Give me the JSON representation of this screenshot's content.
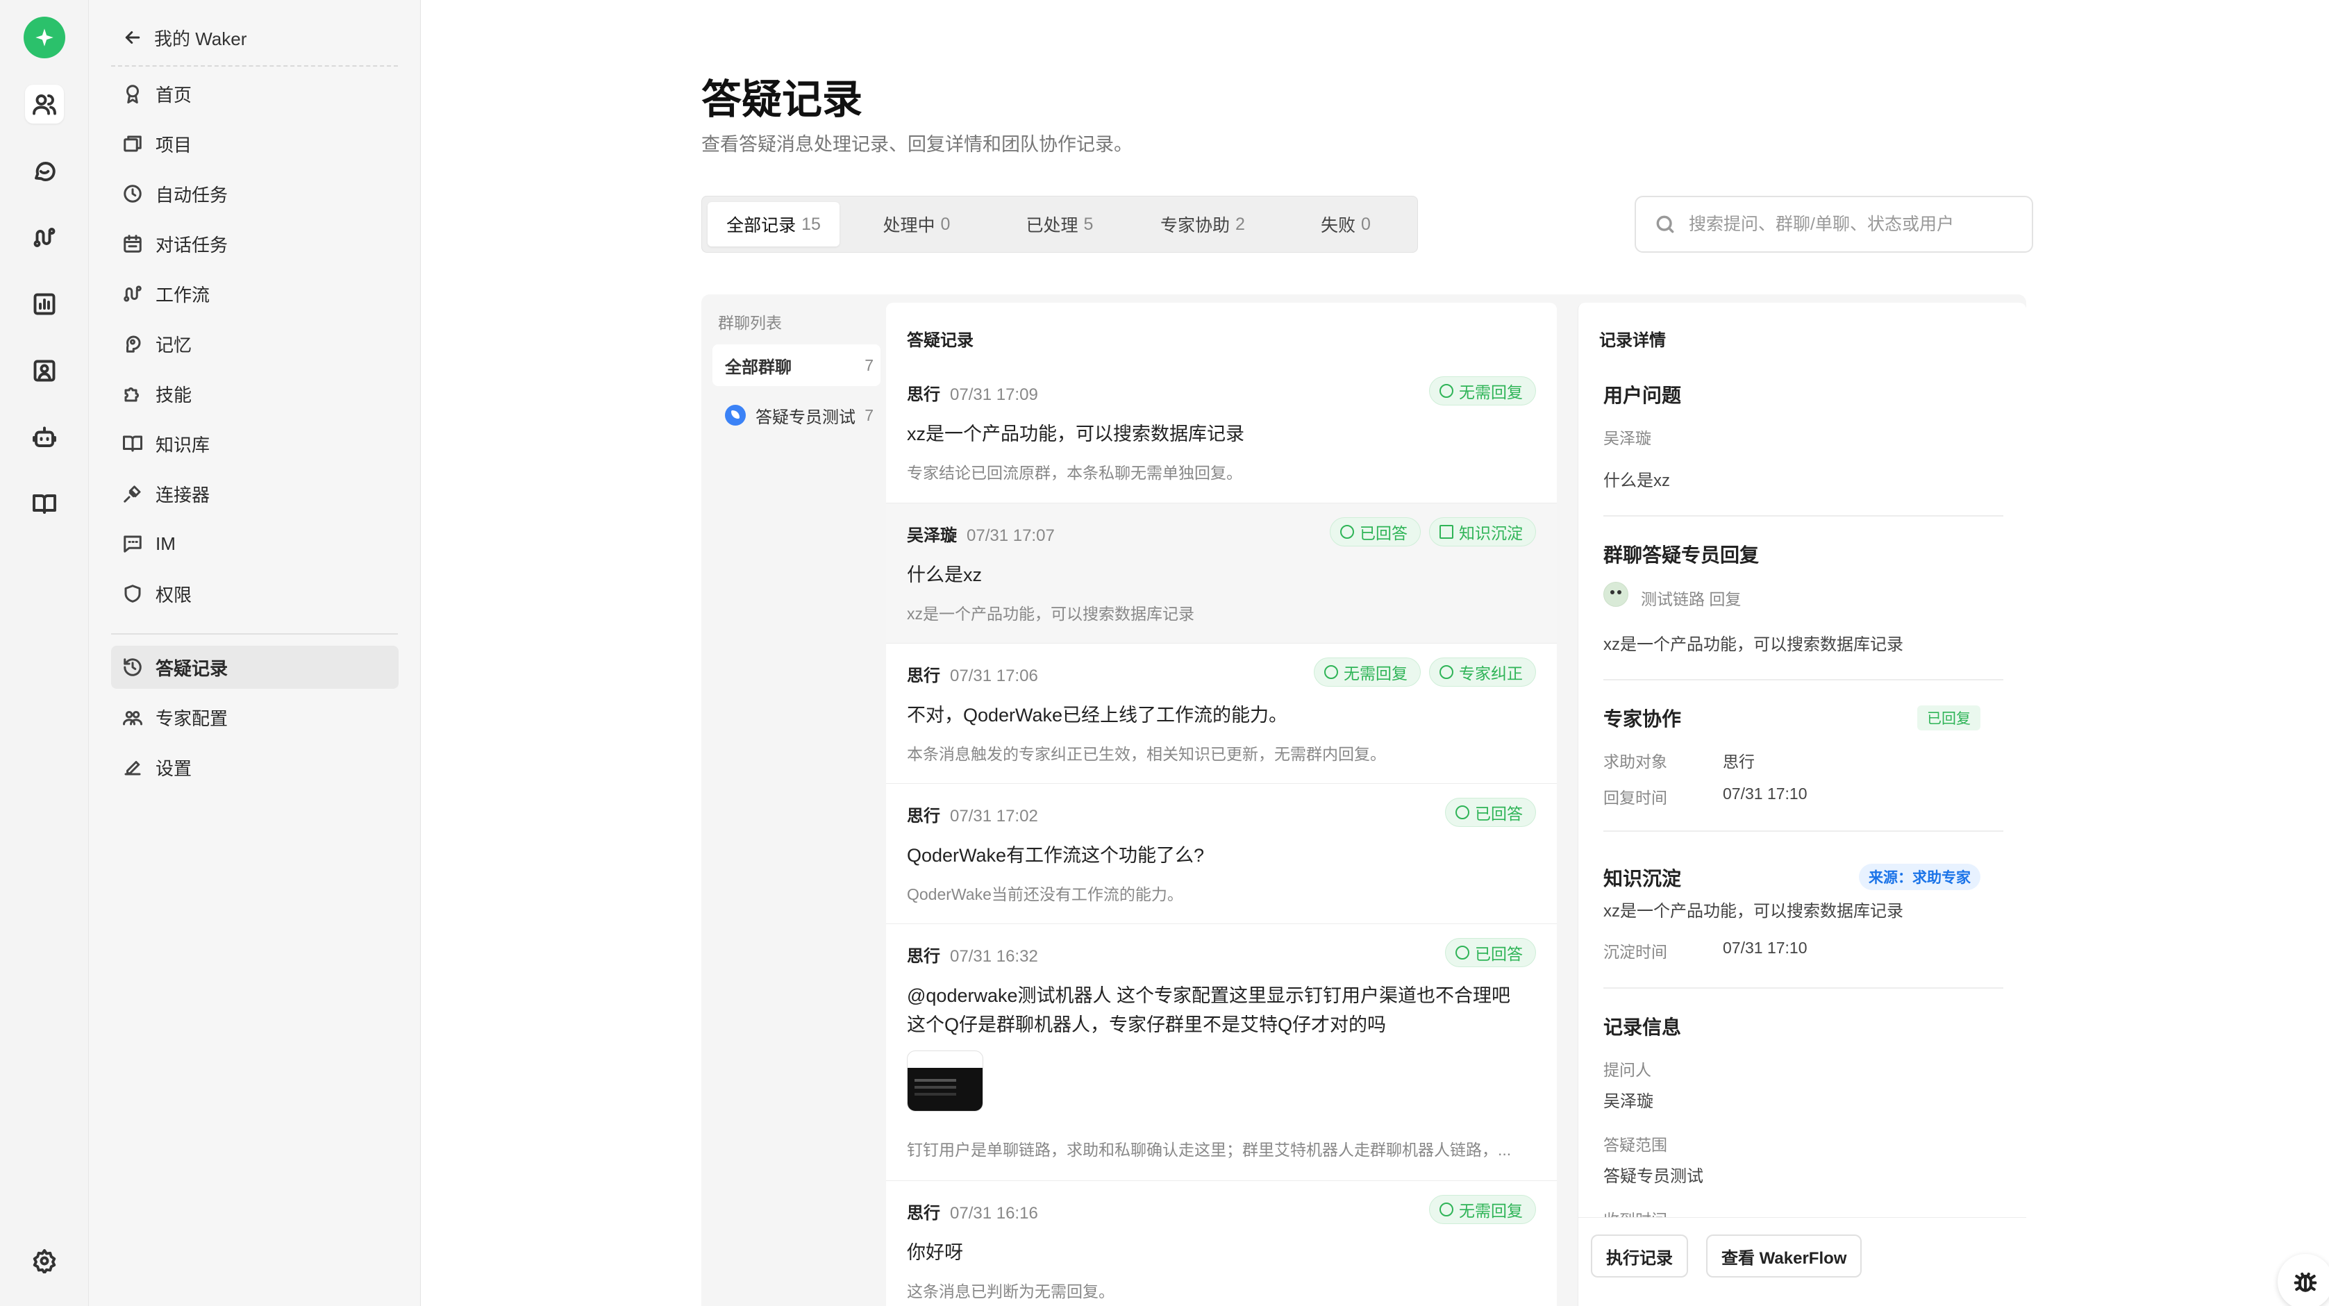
{
  "rail": {
    "items": [
      "users-icon",
      "chat-icon",
      "workflow-icon",
      "chart-icon",
      "contact-icon",
      "robot-icon",
      "book-icon"
    ],
    "bottom": "settings-icon"
  },
  "nav": {
    "back_label": "我的 Waker",
    "items": [
      {
        "label": "首页",
        "icon": "award-icon"
      },
      {
        "label": "项目",
        "icon": "folders-icon"
      },
      {
        "label": "自动任务",
        "icon": "clock-icon"
      },
      {
        "label": "对话任务",
        "icon": "calendar-icon"
      },
      {
        "label": "工作流",
        "icon": "workflow-icon"
      },
      {
        "label": "记忆",
        "icon": "brain-icon"
      },
      {
        "label": "技能",
        "icon": "puzzle-icon"
      },
      {
        "label": "知识库",
        "icon": "book-icon"
      },
      {
        "label": "连接器",
        "icon": "plug-icon"
      },
      {
        "label": "IM",
        "icon": "message-icon"
      },
      {
        "label": "权限",
        "icon": "shield-icon"
      }
    ],
    "items2": [
      {
        "label": "答疑记录",
        "icon": "history-icon",
        "active": true
      },
      {
        "label": "专家配置",
        "icon": "team-icon"
      },
      {
        "label": "设置",
        "icon": "pen-icon"
      }
    ]
  },
  "page": {
    "title": "答疑记录",
    "subtitle": "查看答疑消息处理记录、回复详情和团队协作记录。"
  },
  "tabs": [
    {
      "label": "全部记录",
      "count": "15",
      "active": true
    },
    {
      "label": "处理中",
      "count": "0"
    },
    {
      "label": "已处理",
      "count": "5"
    },
    {
      "label": "专家协助",
      "count": "2"
    },
    {
      "label": "失败",
      "count": "0"
    }
  ],
  "search": {
    "placeholder": "搜索提问、群聊/单聊、状态或用户",
    "value": ""
  },
  "groups": {
    "header": "群聊列表",
    "items": [
      {
        "label": "全部群聊",
        "count": "7",
        "active": true
      },
      {
        "label": "答疑专员测试",
        "count": "7"
      }
    ]
  },
  "records": {
    "header": "答疑记录",
    "items": [
      {
        "user": "思行",
        "time": "07/31 17:09",
        "question": "xz是一个产品功能，可以搜索数据库记录",
        "answer": "专家结论已回流原群，本条私聊无需单独回复。",
        "badges": [
          "无需回复"
        ]
      },
      {
        "user": "吴泽璇",
        "time": "07/31 17:07",
        "question": "什么是xz",
        "answer": "xz是一个产品功能，可以搜索数据库记录",
        "badges": [
          "已回答",
          "知识沉淀"
        ]
      },
      {
        "user": "思行",
        "time": "07/31 17:06",
        "question": "不对，QoderWake已经上线了工作流的能力。",
        "answer": "本条消息触发的专家纠正已生效，相关知识已更新，无需群内回复。",
        "badges": [
          "无需回复",
          "专家纠正"
        ]
      },
      {
        "user": "思行",
        "time": "07/31 17:02",
        "question": "QoderWake有工作流这个功能了么?",
        "answer": "QoderWake当前还没有工作流的能力。",
        "badges": [
          "已回答"
        ]
      },
      {
        "user": "思行",
        "time": "07/31 16:32",
        "question": "@qoderwake测试机器人 这个专家配置这里显示钉钉用户渠道也不合理吧 这个Q仔是群聊机器人，专家仔群里不是艾特Q仔才对的吗",
        "answer": "钉钉用户是单聊链路，求助和私聊确认走这里；群里艾特机器人走群聊机器人链路，...",
        "badges": [
          "已回答"
        ]
      },
      {
        "user": "思行",
        "time": "07/31 16:16",
        "question": "你好呀",
        "answer": "这条消息已判断为无需回复。",
        "badges": [
          "无需回复"
        ]
      }
    ]
  },
  "detail": {
    "header": "记录详情",
    "question": {
      "title": "用户问题",
      "user": "吴泽璇",
      "text": "什么是xz"
    },
    "reply": {
      "title": "群聊答疑专员回复",
      "by": "测试链路 回复",
      "text": "xz是一个产品功能，可以搜索数据库记录"
    },
    "expert": {
      "title": "专家协作",
      "status": "已回复",
      "target_label": "求助对象",
      "target": "思行",
      "time_label": "回复时间",
      "time": "07/31 17:10"
    },
    "knowledge": {
      "title": "知识沉淀",
      "source": "来源：求助专家",
      "text": "xz是一个产品功能，可以搜索数据库记录",
      "time_label": "沉淀时间",
      "time": "07/31 17:10"
    },
    "info": {
      "title": "记录信息",
      "asker_label": "提问人",
      "asker": "吴泽璇",
      "scope_label": "答疑范围",
      "scope": "答疑专员测试",
      "received_label": "收到时间"
    },
    "buttons": {
      "log": "执行记录",
      "flow": "查看 WakerFlow"
    }
  },
  "colors": {
    "accent_green": "#2bc16b",
    "badge_green": "#2fb457",
    "source_blue": "#1a73e8"
  }
}
